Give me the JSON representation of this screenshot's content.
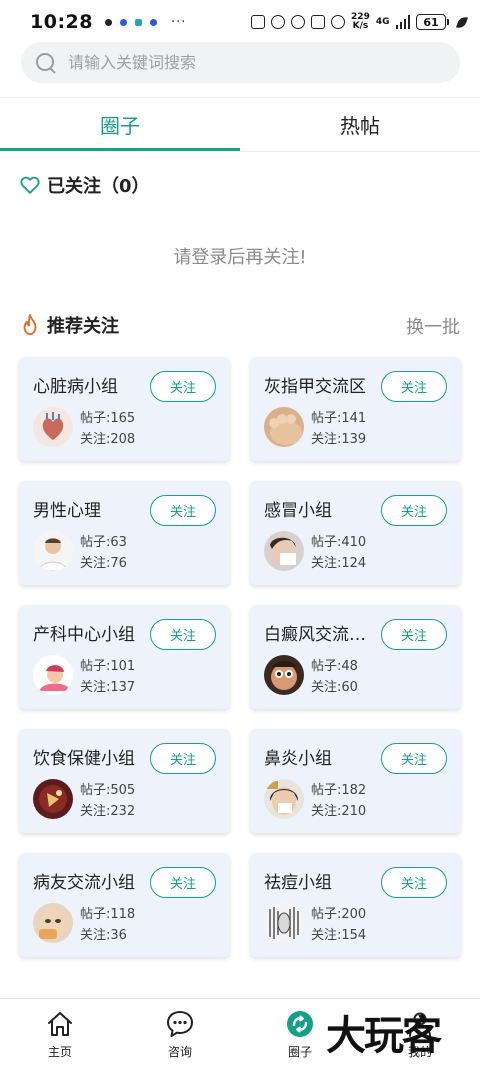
{
  "status_bar": {
    "time": "10:28",
    "more": "···",
    "net_speed_value": "229",
    "net_speed_unit": "K/s",
    "network": "4G",
    "battery": "61"
  },
  "search": {
    "placeholder": "请输入关键词搜索"
  },
  "tabs": [
    {
      "label": "圈子",
      "active": true
    },
    {
      "label": "热帖",
      "active": false
    }
  ],
  "followed": {
    "title": "已关注（0）",
    "empty_hint": "请登录后再关注!"
  },
  "recommend": {
    "title": "推荐关注",
    "refresh_label": "换一批",
    "follow_label": "关注",
    "groups": [
      {
        "name": "心脏病小组",
        "posts": "帖子:165",
        "followers": "关注:208",
        "avatar": "heart-anatomy"
      },
      {
        "name": "灰指甲交流区",
        "posts": "帖子:141",
        "followers": "关注:139",
        "avatar": "toe"
      },
      {
        "name": "男性心理",
        "posts": "帖子:63",
        "followers": "关注:76",
        "avatar": "man"
      },
      {
        "name": "感冒小组",
        "posts": "帖子:410",
        "followers": "关注:124",
        "avatar": "woman-tissue"
      },
      {
        "name": "产科中心小组",
        "posts": "帖子:101",
        "followers": "关注:137",
        "avatar": "baby"
      },
      {
        "name": "白癜风交流…",
        "posts": "帖子:48",
        "followers": "关注:60",
        "avatar": "cartoon-face"
      },
      {
        "name": "饮食保健小组",
        "posts": "帖子:505",
        "followers": "关注:232",
        "avatar": "food"
      },
      {
        "name": "鼻炎小组",
        "posts": "帖子:182",
        "followers": "关注:210",
        "avatar": "woman-sneezing"
      },
      {
        "name": "病友交流小组",
        "posts": "帖子:118",
        "followers": "关注:36",
        "avatar": "person-face"
      },
      {
        "name": "祛痘小组",
        "posts": "帖子:200",
        "followers": "关注:154",
        "avatar": "sketch"
      }
    ]
  },
  "bottom_nav": [
    {
      "label": "主页",
      "icon": "home-icon"
    },
    {
      "label": "咨询",
      "icon": "chat-icon"
    },
    {
      "label": "圈子",
      "icon": "circle-icon",
      "active": true
    },
    {
      "label": "我的",
      "icon": "profile-icon"
    }
  ],
  "watermark": "大玩客",
  "colors": {
    "accent": "#16a08a",
    "card_bg": "#eef3fb",
    "muted": "#8c8c8c",
    "fire": "#e8682a"
  }
}
